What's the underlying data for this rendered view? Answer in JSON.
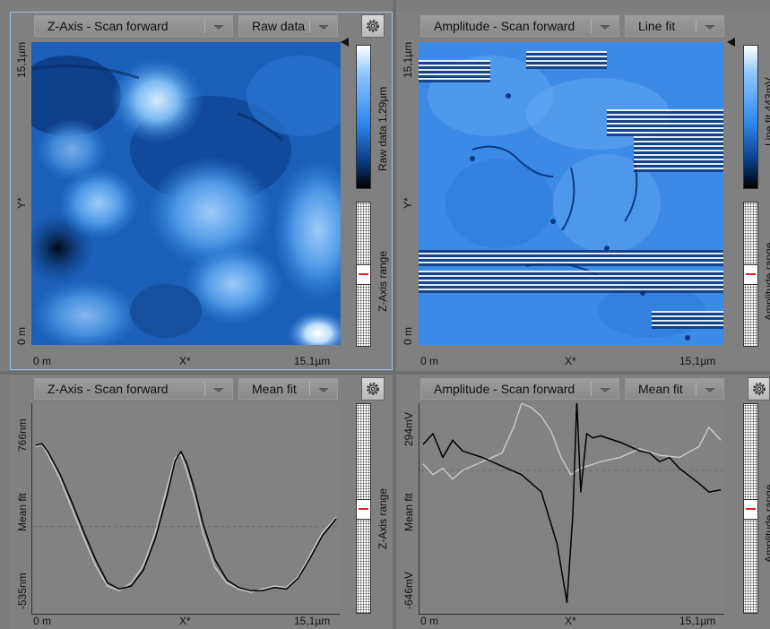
{
  "panels": [
    {
      "id": "top-left",
      "channel": "Z-Axis - Scan forward",
      "filter": "Raw data",
      "y_top": "15,1µm",
      "y_mid": "Y*",
      "y_bottom": "0 m",
      "x_left": "0 m",
      "x_mid": "X*",
      "x_right": "15,1µm",
      "colorbar_label": "Raw data 1,29µm",
      "range_label": "Z-Axis range"
    },
    {
      "id": "top-right",
      "channel": "Amplitude - Scan forward",
      "filter": "Line fit",
      "y_top": "15,1µm",
      "y_mid": "Y*",
      "y_bottom": "0 m",
      "x_left": "0 m",
      "x_mid": "X*",
      "x_right": "15,1µm",
      "colorbar_label": "Line fit 443mV",
      "range_label": "Amplitude range"
    },
    {
      "id": "bottom-left",
      "channel": "Z-Axis - Scan forward",
      "filter": "Mean fit",
      "y_top": "766nm",
      "y_mid": "Mean fit",
      "y_bottom": "-535nm",
      "x_left": "0 m",
      "x_mid": "X*",
      "x_right": "15,1µm",
      "range_label": "Z-Axis range"
    },
    {
      "id": "bottom-right",
      "channel": "Amplitude - Scan forward",
      "filter": "Mean fit",
      "y_top": "294mV",
      "y_mid": "Mean fit",
      "y_bottom": "-646mV",
      "x_left": "0 m",
      "x_mid": "X*",
      "x_right": "15,1µm",
      "range_label": "Amplitude range"
    }
  ],
  "chart_data": [
    {
      "type": "line",
      "panel": "bottom-left",
      "ylabel": "Mean fit",
      "xlabel": "X*",
      "x_range": [
        0,
        15.1
      ],
      "y_range": [
        -535,
        766
      ],
      "series": [
        {
          "color": "#000000",
          "x": [
            0,
            0.3,
            0.6,
            1.2,
            1.8,
            2.4,
            3.0,
            3.6,
            4.2,
            4.8,
            5.4,
            6.0,
            6.6,
            7.0,
            7.3,
            7.6,
            8.0,
            8.4,
            9.0,
            9.6,
            10.2,
            10.8,
            11.4,
            12.0,
            12.6,
            13.2,
            13.8,
            14.4,
            15.1
          ],
          "y": [
            520,
            530,
            480,
            340,
            160,
            -30,
            -210,
            -360,
            -400,
            -380,
            -280,
            -80,
            200,
            420,
            480,
            400,
            230,
            20,
            -210,
            -340,
            -390,
            -410,
            -410,
            -390,
            -400,
            -330,
            -200,
            -60,
            50
          ]
        },
        {
          "color": "#c8c8c8",
          "x": [
            0,
            0.3,
            0.6,
            1.2,
            1.8,
            2.4,
            3.0,
            3.6,
            4.2,
            4.8,
            5.4,
            6.0,
            6.6,
            7.0,
            7.3,
            7.6,
            8.0,
            8.4,
            9.0,
            9.6,
            10.2,
            10.8,
            11.4,
            12.0,
            12.6,
            13.2,
            13.8,
            14.4,
            15.1
          ],
          "y": [
            510,
            525,
            460,
            310,
            120,
            -70,
            -250,
            -380,
            -410,
            -360,
            -250,
            -40,
            250,
            440,
            460,
            350,
            170,
            -40,
            -260,
            -360,
            -400,
            -420,
            -400,
            -380,
            -390,
            -320,
            -180,
            -40,
            60
          ]
        }
      ]
    },
    {
      "type": "line",
      "panel": "bottom-right",
      "ylabel": "Mean fit",
      "xlabel": "X*",
      "x_range": [
        0,
        15.1
      ],
      "y_range": [
        -646,
        294
      ],
      "series": [
        {
          "color": "#000000",
          "x": [
            0,
            0.5,
            1.0,
            1.5,
            2.0,
            3.0,
            4.0,
            5.0,
            6.0,
            6.8,
            7.3,
            7.6,
            7.8,
            8.0,
            8.3,
            8.6,
            9.0,
            10.0,
            11.0,
            11.5,
            12.0,
            12.5,
            13.0,
            14.0,
            14.5,
            15.1
          ],
          "y": [
            120,
            170,
            60,
            140,
            90,
            60,
            20,
            -20,
            -100,
            -340,
            -610,
            -200,
            320,
            -100,
            170,
            150,
            160,
            130,
            90,
            80,
            40,
            60,
            10,
            -60,
            -100,
            -90
          ]
        },
        {
          "color": "#c8c8c8",
          "x": [
            0,
            0.5,
            1.0,
            1.5,
            2.0,
            3.0,
            4.0,
            4.6,
            5.0,
            5.5,
            6.0,
            6.5,
            7.0,
            7.5,
            8.0,
            9.0,
            10.0,
            11.0,
            12.0,
            13.0,
            14.0,
            14.5,
            15.1
          ],
          "y": [
            30,
            -20,
            10,
            -40,
            0,
            40,
            80,
            200,
            310,
            290,
            250,
            180,
            60,
            -20,
            10,
            40,
            60,
            100,
            70,
            60,
            110,
            200,
            140
          ]
        }
      ]
    }
  ]
}
